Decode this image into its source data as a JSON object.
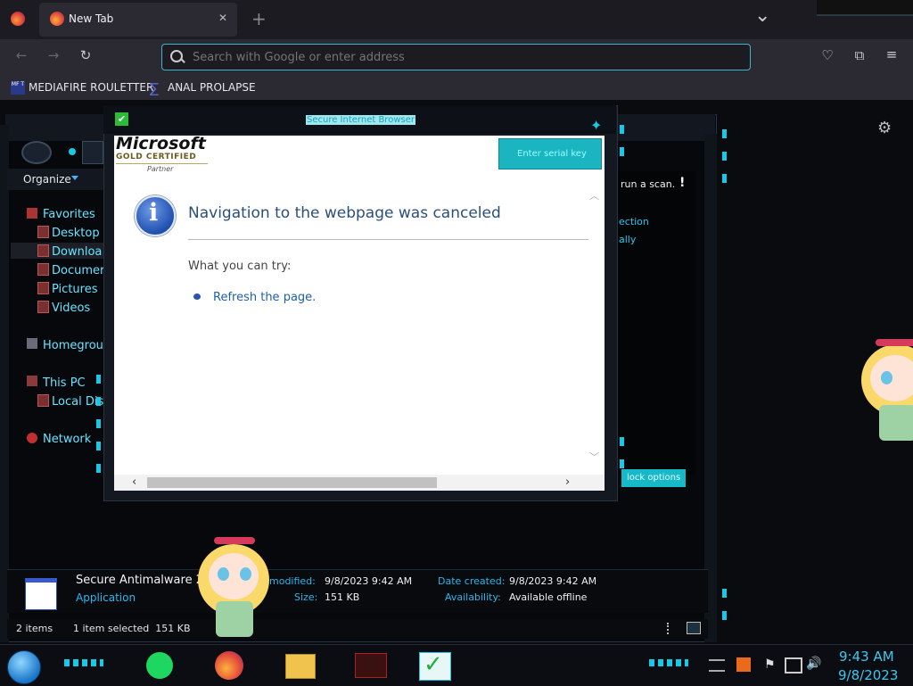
{
  "browser": {
    "tab_title": "New Tab",
    "new_tab_symbol": "+",
    "tab_close_symbol": "✕",
    "tab_list_symbol": "⌄",
    "search_placeholder": "Search with Google or enter address",
    "bookmarks": [
      {
        "label": "MEDIAFIRE ROULETTER",
        "icon_text": "MF T"
      },
      {
        "label": "ANAL PROLAPSE",
        "icon_text": "∑"
      }
    ]
  },
  "explorer": {
    "organize_label": "Organize",
    "nav_groups": [
      {
        "label": "Favorites"
      },
      {
        "label": "Desktop"
      },
      {
        "label": "Downloa"
      },
      {
        "label": "Documer"
      },
      {
        "label": "Pictures"
      },
      {
        "label": "Videos"
      },
      {
        "label": "Homegroup"
      },
      {
        "label": "This PC"
      },
      {
        "label": "Local Dis"
      },
      {
        "label": "Network"
      }
    ],
    "right_panel": {
      "scan_text": "run a scan.",
      "exclaim": "!",
      "link1": "ection",
      "link2": "ally",
      "button": "lock options"
    },
    "details": {
      "name": "Secure Antimalware 20",
      "type": "Application",
      "modified_label": "modified:",
      "modified_value": "9/8/2023 9:42 AM",
      "size_label": "Size:",
      "size_value": "151 KB",
      "created_label": "Date created:",
      "created_value": "9/8/2023 9:42 AM",
      "availability_label": "Availability:",
      "availability_value": "Available offline"
    },
    "status": {
      "items": "2 items",
      "selected": "1 item selected  151 KB"
    }
  },
  "dialog": {
    "title": "Secure Internet Browser",
    "ms_logo_text": "Microsoft",
    "ms_gold": "GOLD CERTIFIED",
    "ms_partner": "Partner",
    "serial_button": "Enter serial key",
    "heading": "Navigation to the webpage was canceled",
    "try_label": "What you can try:",
    "refresh_link": "Refresh the page.",
    "info_icon": "i",
    "check_icon": "✔"
  },
  "taskbar": {
    "time": "9:43 AM",
    "date": "9/8/2023"
  },
  "colors": {
    "accent_cyan": "#18c8e6",
    "link_blue": "#1f5fa8",
    "heading_text": "#2a4f7a"
  }
}
